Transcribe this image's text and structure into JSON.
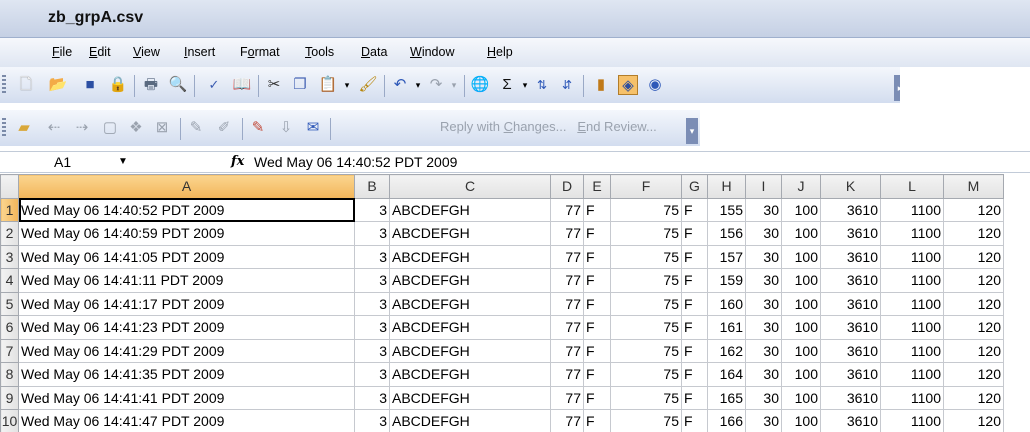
{
  "window": {
    "title": "zb_grpA.csv"
  },
  "menu": {
    "items": [
      {
        "ul": "F",
        "rest": "ile"
      },
      {
        "ul": "E",
        "rest": "dit"
      },
      {
        "ul": "V",
        "rest": "iew"
      },
      {
        "ul": "I",
        "rest": "nsert"
      },
      {
        "pre": "F",
        "ul": "o",
        "rest": "rmat"
      },
      {
        "ul": "T",
        "rest": "ools"
      },
      {
        "ul": "D",
        "rest": "ata"
      },
      {
        "ul": "W",
        "rest": "indow"
      },
      {
        "ul": "H",
        "rest": "elp"
      }
    ]
  },
  "toolbar2": {
    "reply_pre": "Reply with ",
    "reply_ul": "C",
    "reply_post": "hanges...",
    "end_ul": "E",
    "end_post": "nd Review..."
  },
  "formula": {
    "name_box": "A1",
    "fx": "fx",
    "content": "Wed May 06 14:40:52 PDT 2009"
  },
  "sheet": {
    "columns": [
      "A",
      "B",
      "C",
      "D",
      "E",
      "F",
      "G",
      "H",
      "I",
      "J",
      "K",
      "L",
      "M"
    ],
    "rows": [
      {
        "n": "1",
        "cells": [
          "Wed May 06 14:40:52 PDT 2009",
          "3",
          "ABCDEFGH",
          "77",
          "F",
          "75",
          "F",
          "155",
          "30",
          "100",
          "3610",
          "1100",
          "120"
        ]
      },
      {
        "n": "2",
        "cells": [
          "Wed May 06 14:40:59 PDT 2009",
          "3",
          "ABCDEFGH",
          "77",
          "F",
          "75",
          "F",
          "156",
          "30",
          "100",
          "3610",
          "1100",
          "120"
        ]
      },
      {
        "n": "3",
        "cells": [
          "Wed May 06 14:41:05 PDT 2009",
          "3",
          "ABCDEFGH",
          "77",
          "F",
          "75",
          "F",
          "157",
          "30",
          "100",
          "3610",
          "1100",
          "120"
        ]
      },
      {
        "n": "4",
        "cells": [
          "Wed May 06 14:41:11 PDT 2009",
          "3",
          "ABCDEFGH",
          "77",
          "F",
          "75",
          "F",
          "159",
          "30",
          "100",
          "3610",
          "1100",
          "120"
        ]
      },
      {
        "n": "5",
        "cells": [
          "Wed May 06 14:41:17 PDT 2009",
          "3",
          "ABCDEFGH",
          "77",
          "F",
          "75",
          "F",
          "160",
          "30",
          "100",
          "3610",
          "1100",
          "120"
        ]
      },
      {
        "n": "6",
        "cells": [
          "Wed May 06 14:41:23 PDT 2009",
          "3",
          "ABCDEFGH",
          "77",
          "F",
          "75",
          "F",
          "161",
          "30",
          "100",
          "3610",
          "1100",
          "120"
        ]
      },
      {
        "n": "7",
        "cells": [
          "Wed May 06 14:41:29 PDT 2009",
          "3",
          "ABCDEFGH",
          "77",
          "F",
          "75",
          "F",
          "162",
          "30",
          "100",
          "3610",
          "1100",
          "120"
        ]
      },
      {
        "n": "8",
        "cells": [
          "Wed May 06 14:41:35 PDT 2009",
          "3",
          "ABCDEFGH",
          "77",
          "F",
          "75",
          "F",
          "164",
          "30",
          "100",
          "3610",
          "1100",
          "120"
        ]
      },
      {
        "n": "9",
        "cells": [
          "Wed May 06 14:41:41 PDT 2009",
          "3",
          "ABCDEFGH",
          "77",
          "F",
          "75",
          "F",
          "165",
          "30",
          "100",
          "3610",
          "1100",
          "120"
        ]
      },
      {
        "n": "10",
        "cells": [
          "Wed May 06 14:41:47 PDT 2009",
          "3",
          "ABCDEFGH",
          "77",
          "F",
          "75",
          "F",
          "166",
          "30",
          "100",
          "3610",
          "1100",
          "120"
        ]
      }
    ]
  },
  "icons": [
    "new-icon",
    "open-icon",
    "save-icon",
    "permission-icon",
    "print-icon",
    "print-preview-icon",
    "spelling-icon",
    "research-icon",
    "cut-icon",
    "copy-icon",
    "paste-icon",
    "format-painter-icon",
    "undo-icon",
    "redo-icon",
    "hyperlink-icon",
    "autosum-icon",
    "sort-ascending-icon",
    "sort-descending-icon",
    "chart-wizard-icon",
    "drawing-icon",
    "help-icon"
  ],
  "colors": {
    "selected_header": "#f2b55a",
    "toolbar": "#d3ddef"
  }
}
